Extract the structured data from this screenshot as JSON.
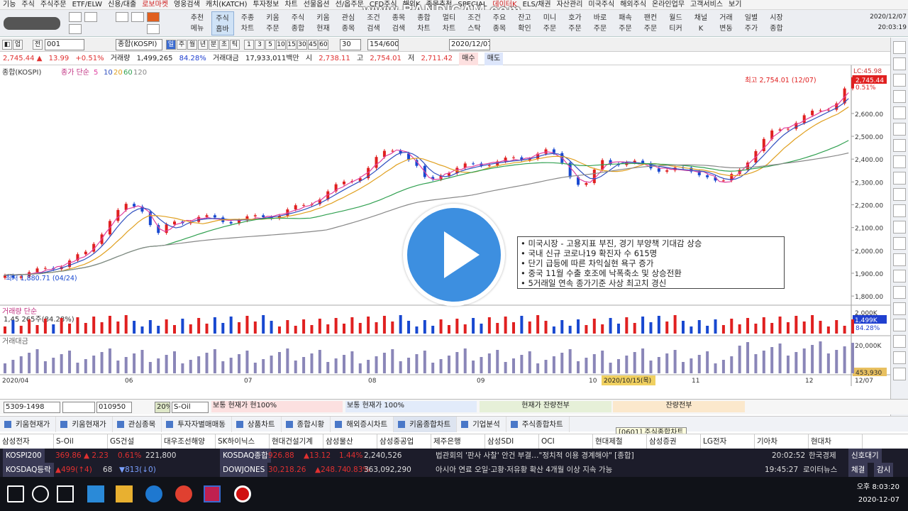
{
  "menu": [
    "기능",
    "주식",
    "주식주문",
    "ETF/ELW",
    "신용/대출",
    "로보마켓",
    "영웅검색",
    "캐치(KATCH)",
    "투자정보",
    "차트",
    "선물옵션",
    "선/옵주문",
    "CFD주식",
    "해외K",
    "종목추천",
    "SPECIAL",
    "데이터K",
    "ELS/채권",
    "자산관리",
    "미국주식",
    "해외주식",
    "온라인업무",
    "고객서비스",
    "보기"
  ],
  "watermark": "www.BANDICAM.com",
  "toolbar": {
    "buttons": [
      [
        "추천",
        "메뉴"
      ],
      [
        "주식",
        "홈바"
      ],
      [
        "주종",
        "차트"
      ],
      [
        "키움",
        "주문"
      ],
      [
        "주식",
        "종합"
      ],
      [
        "키움",
        "현재"
      ],
      [
        "관심",
        "종목"
      ],
      [
        "조건",
        "검색"
      ],
      [
        "종목",
        "검색"
      ],
      [
        "종합",
        "차트"
      ],
      [
        "멀티",
        "차트"
      ],
      [
        "조건",
        "스탁"
      ],
      [
        "주요",
        "종목"
      ],
      [
        "잔고",
        "확인"
      ],
      [
        "미니",
        "주문"
      ],
      [
        "호가",
        "주문"
      ],
      [
        "바로",
        "주문"
      ],
      [
        "패속",
        "주문"
      ],
      [
        "팬컨",
        "주문"
      ],
      [
        "월드",
        "티커"
      ],
      [
        "채널",
        "K"
      ],
      [
        "거래",
        "변동"
      ],
      [
        "일별",
        "주가"
      ],
      [
        "시장",
        "종합"
      ]
    ],
    "date": "2020/12/07",
    "time": "20:03:19"
  },
  "ctrl1": {
    "code": "001",
    "name": "종합(KOSPI)",
    "periods": [
      "일",
      "주",
      "월",
      "년",
      "분",
      "초",
      "틱"
    ],
    "nums": [
      "1",
      "3",
      "5",
      "10",
      "15",
      "30",
      "45",
      "60"
    ],
    "num2": "30",
    "count": "154/600",
    "date": "2020/12/07"
  },
  "ctrl2": {
    "price": "2,745.44 ▲",
    "chg": "13.99",
    "pct": "+0.51%",
    "vol_label": "거래량",
    "vol": "1,499,265",
    "vol_pct": "84.28%",
    "amt_label": "거래대금",
    "amt": "17,933,011백만",
    "si_label": "시",
    "si": "2,738.11",
    "go_label": "고",
    "go": "2,754.01",
    "jeo_label": "저",
    "jeo": "2,711.42",
    "buy": "매수",
    "sell": "매도"
  },
  "chart_data": {
    "type": "candlestick",
    "title": "종합(KOSPI)",
    "indicator_label": "종가 단순",
    "ma_periods": [
      "5",
      "10",
      "20",
      "60",
      "120"
    ],
    "ma_colors": [
      "#e040a0",
      "#3050c0",
      "#e0a020",
      "#30a050",
      "#888888"
    ],
    "x_labels": [
      "2020/04",
      "06",
      "07",
      "08",
      "09",
      "10",
      "11",
      "12",
      "12/07"
    ],
    "y_ticks": [
      "2,600.00",
      "2,500.00",
      "2,400.00",
      "2,300.00",
      "2,200.00",
      "2,100.00",
      "2,000.00",
      "1,900.00",
      "1,800.00"
    ],
    "ylim": [
      1760,
      2780
    ],
    "high_note": "최고 2,754.01 (12/07)",
    "high_pct": "0.51%",
    "low_note": "최저 1,880.71 (04/24)",
    "last": "2,745.44",
    "lc": "LC:45.98",
    "crosshair_date": "2020/10/15(목)",
    "volume_label": "거래량 단순",
    "volume_text": "1,45 265주(84.28%)",
    "volume_tick": "2,000K",
    "volume_last": "1,499K",
    "volume_pct": "84.28%",
    "amount_label": "거래대금",
    "amount_tick": "20,000K",
    "amount_last": "453,930",
    "keypoints": [
      [
        0,
        1890
      ],
      [
        10,
        1900
      ],
      [
        20,
        1935
      ],
      [
        30,
        1985
      ],
      [
        40,
        2150
      ],
      [
        46,
        2200
      ],
      [
        52,
        2180
      ],
      [
        56,
        2060
      ],
      [
        62,
        2120
      ],
      [
        72,
        2145
      ],
      [
        82,
        2130
      ],
      [
        92,
        2140
      ],
      [
        102,
        2160
      ],
      [
        112,
        2200
      ],
      [
        122,
        2270
      ],
      [
        132,
        2330
      ],
      [
        140,
        2420
      ],
      [
        146,
        2450
      ],
      [
        152,
        2380
      ],
      [
        157,
        2290
      ],
      [
        162,
        2340
      ],
      [
        172,
        2370
      ],
      [
        182,
        2390
      ],
      [
        192,
        2400
      ],
      [
        200,
        2440
      ],
      [
        206,
        2400
      ],
      [
        212,
        2300
      ],
      [
        216,
        2290
      ],
      [
        222,
        2390
      ],
      [
        232,
        2385
      ],
      [
        242,
        2360
      ],
      [
        252,
        2350
      ],
      [
        260,
        2340
      ],
      [
        266,
        2280
      ],
      [
        270,
        2330
      ],
      [
        278,
        2420
      ],
      [
        286,
        2530
      ],
      [
        292,
        2550
      ],
      [
        300,
        2600
      ],
      [
        306,
        2630
      ],
      [
        310,
        2660
      ],
      [
        314,
        2745
      ]
    ]
  },
  "overlay": [
    "• 미국시장 - 고용지표 부진, 경기 부양책 기대감 상승",
    "• 국내 신규 코로나19 확진자 수 615명",
    "• 단기 급등에 따른 차익실현 욕구 증가",
    "• 중국 11월 수출 호조에 낙폭축소 및 상승전환",
    "• 5거래일 연속 종가기준 사상 최고치 경신"
  ],
  "order": {
    "acct": "5309-1498",
    "code": "010950",
    "pct": "20%",
    "name": "S-Oil",
    "a": "보통  현재가",
    "b": "현100%",
    "c": "보통  현재가",
    "d": "100%",
    "e": "현재가    잔량전부",
    "f": "잔량전부"
  },
  "tabs": [
    "키움현재가",
    "키움현재가",
    "관심종목",
    "투자자별매매동",
    "상품차트",
    "종합시황",
    "해외증시차트",
    "키움종합차트",
    "기업분석",
    "주식종합차트"
  ],
  "tooltip": "[0601] 주식종합차트",
  "stocks": [
    "삼성전자",
    "S-Oil",
    "GS건설",
    "대우조선해양",
    "SK하이닉스",
    "현대건설기계",
    "삼성물산",
    "삼성중공업",
    "제주은행",
    "삼성SDI",
    "OCI",
    "현대제철",
    "삼성증권",
    "LG전자",
    "기아차",
    "현대차"
  ],
  "t1": {
    "n1": "KOSPI200",
    "v1": "369.86",
    "c1": "▲ 2.23",
    "p1": "0.61%",
    "a1": "221,800",
    "n2": "KOSDAQ종합",
    "v2": "926.88",
    "c2": "▲13.12",
    "p2": "1.44%",
    "a2": "2,240,526",
    "news": "법관회의 '판사 사찰' 안건 부결…\"정치적 이용 경계해야\" [종합]",
    "time": "20:02:52",
    "src": "한국경제",
    "btn": "신호대기"
  },
  "t2": {
    "n1": "KOSDAQ등락",
    "v1": "▲499(↑4)",
    "c1": "68",
    "p1": "▼813(↓0)",
    "n2": "DOWJONES",
    "v2": "30,218.26",
    "c2": "▲248.74",
    "p2": "0.83%",
    "a2": "363,092,290",
    "news": "아시아 연료 오일·고황·저유황 확산 4개월 이상 지속 가능",
    "time": "19:45:27",
    "src": "로이터뉴스",
    "btn1": "체결",
    "btn2": "감시"
  },
  "clock": {
    "ampm": "오후 8:03:20",
    "date": "2020-12-07"
  }
}
